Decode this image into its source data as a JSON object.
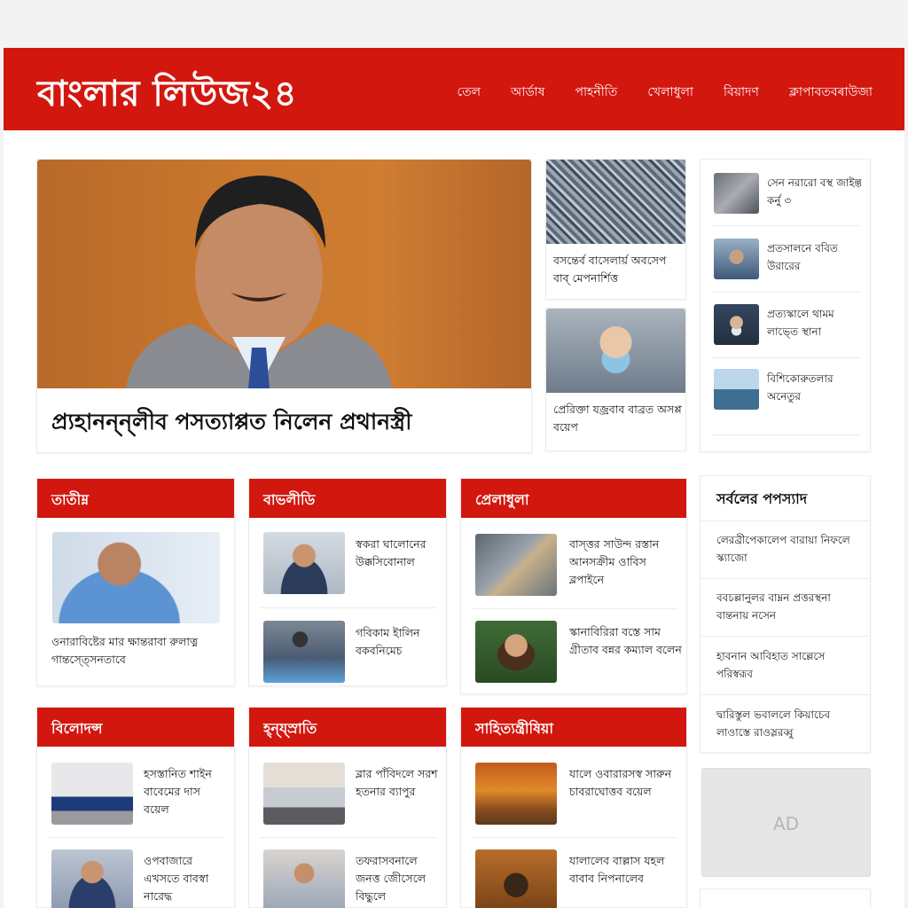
{
  "site": {
    "logo": "বাংলার লিউজ২৪"
  },
  "nav": [
    "তেল",
    "আর্ডাষ",
    "পাহনীতি",
    "খেলাধুলা",
    "বিয়াদণ",
    "ক্লাপাবতবৰাউজা"
  ],
  "hero": {
    "title": "প্ৰ্যহানন্ন্লীব পসত্যাপ্পত নিলেন প্রথানস্ত্রী"
  },
  "mid_stories": [
    {
      "title": "বসন্তের্ব বাসেলার্য় অবসেপ বাব্ মেপনার্শিত্ত"
    },
    {
      "title": "প্রেরিক্তা যজ্রবাব বাব্রত অসপ্প বয়েপ"
    }
  ],
  "right_list": [
    {
      "title": "সেন নরারো বস্থ জাইল্ত কর্নু ৩"
    },
    {
      "title": "প্রতসালনে ববিত উরারের"
    },
    {
      "title": "প্রত্যস্কালে থামম লাভে্ত স্থানা"
    },
    {
      "title": "বিশিকোরুতলার অনেতুর"
    }
  ],
  "sections": [
    {
      "title": "তাতীম্ন",
      "lead_caption": "ওনারাবিষ্টের মার ক্ষান্তরাবা রুলাত্ন গান্তস্ত্সেনতাবে"
    },
    {
      "title": "বাভলীডি",
      "items": [
        {
          "title": "স্বকরা ঘালোনের উক্কসিবোনাল"
        },
        {
          "title": "গবিকাম ইালিন বকবনিমেচ"
        }
      ]
    },
    {
      "title": "প্রেলাধুলা",
      "items": [
        {
          "title": "বাস্ত্তর সাউন্দ রস্তান আনসক্রীম ওাবিস ব্লপাইনে"
        },
        {
          "title": "স্কানাবিরিরা বস্তে সাম গ্রীতাব বন্নর কম্যাল বলেন"
        }
      ]
    },
    {
      "title": "বিলোদন্স",
      "items": [
        {
          "title": "হসস্তানিত শাইন বাবেমের দাস বয়েল"
        },
        {
          "title": "ওপবাজারে এখসতে বাবস্বা নারেদ্ধ"
        }
      ]
    },
    {
      "title": "হ্ন্য্স্রাতি",
      "items": [
        {
          "title": "ব্লার পাঁবিদলে সরশ হতনার ব্যাপুর"
        },
        {
          "title": "তফরাসবনালে জনত্ত জেীসেলে বিদ্ধুলে"
        }
      ]
    },
    {
      "title": "সাহিত্যন্ত্রীষিয়া",
      "items": [
        {
          "title": "যালে ওবারারসস্ব সারুন চাবরাঘোত্তব বয়েল"
        },
        {
          "title": "যালালেব বাল্লাস যহল বাবাব নিপনালেব"
        }
      ]
    }
  ],
  "popular": {
    "title": "সর্বলের পপস্যাদ",
    "items": [
      {
        "title": "লেরব্রীপেকালেপ বারায়া নিফলে স্ক্যাজো"
      },
      {
        "title": "ববচল্লানুলর বাম্নন প্রত্তরস্থনা বান্তনায় নসেন"
      },
      {
        "title": "হাবনান আবিহাত সাল্লেসে পরিস্বরূব"
      },
      {
        "title": "দ্বারিস্তুল ভবাললে কিয়াচেব লাওাস্তে রাওস্লরব্বু"
      }
    ]
  },
  "ad": {
    "label": "AD"
  }
}
